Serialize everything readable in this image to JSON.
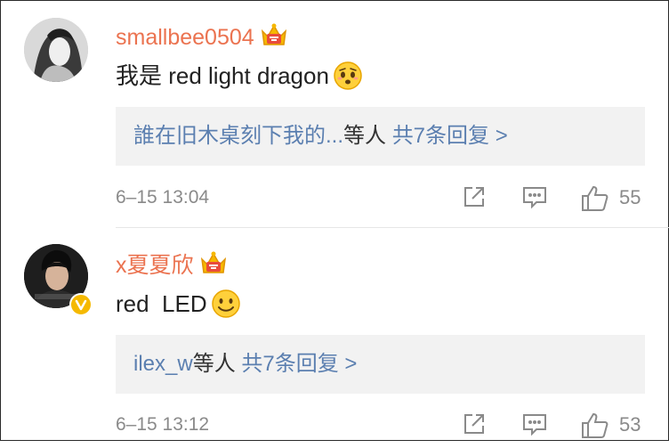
{
  "comments": [
    {
      "username": "smallbee0504",
      "text": "我是 red light dragon",
      "emoji": "worried-face-emoji",
      "replies": {
        "preview": "誰在旧木桌刻下我的...",
        "suffix": "等人",
        "count_link": "共7条回复 >"
      },
      "time": "6–15 13:04",
      "likes": "55"
    },
    {
      "username": "x夏夏欣",
      "text": "red  LED",
      "emoji": "smile-face-emoji",
      "replies": {
        "preview": "ilex_w",
        "suffix": "等人",
        "count_link": "共7条回复 >"
      },
      "time": "6–15 13:12",
      "likes": "53"
    }
  ],
  "colors": {
    "username": "#eb7350",
    "link": "#5b7fb0",
    "meta": "#8a8a8a",
    "reply_bg": "#f2f2f2"
  }
}
